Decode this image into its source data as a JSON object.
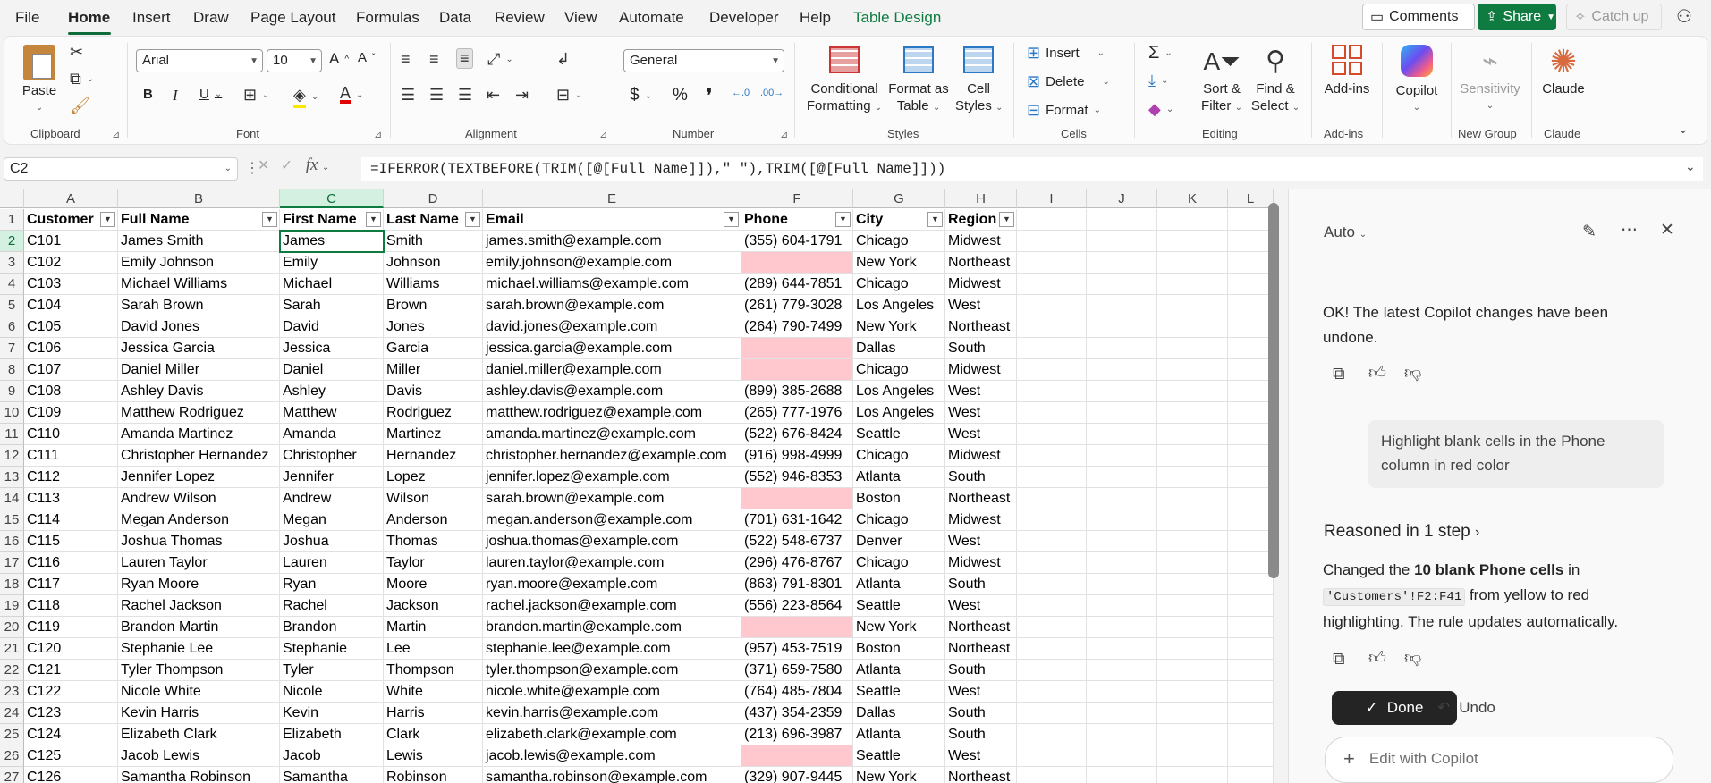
{
  "menu": {
    "items": [
      "File",
      "Home",
      "Insert",
      "Draw",
      "Page Layout",
      "Formulas",
      "Data",
      "Review",
      "View",
      "Automate",
      "Developer",
      "Help",
      "Table Design"
    ],
    "comments": "Comments",
    "share": "Share",
    "catchup": "Catch up"
  },
  "ribbon": {
    "clipboard": {
      "paste": "Paste",
      "group": "Clipboard"
    },
    "font": {
      "name": "Arial",
      "size": "10",
      "group": "Font"
    },
    "alignment": {
      "group": "Alignment"
    },
    "number": {
      "format": "General",
      "group": "Number"
    },
    "styles": {
      "cond1": "Conditional",
      "cond2": "Formatting",
      "fmt1": "Format as",
      "fmt2": "Table",
      "cell1": "Cell",
      "cell2": "Styles",
      "group": "Styles"
    },
    "cells": {
      "insert": "Insert",
      "delete": "Delete",
      "format": "Format",
      "group": "Cells"
    },
    "editing": {
      "sort1": "Sort &",
      "sort2": "Filter",
      "find1": "Find &",
      "find2": "Select",
      "group": "Editing"
    },
    "addins": {
      "label": "Add-ins",
      "group": "Add-ins"
    },
    "copilot": {
      "label": "Copilot"
    },
    "newgroup": {
      "label": "Sensitivity",
      "group": "New Group"
    },
    "claude": {
      "label": "Claude",
      "group": "Claude"
    }
  },
  "formula_bar": {
    "name_box": "C2",
    "formula": "=IFERROR(TEXTBEFORE(TRIM([@[Full Name]]),\" \"),TRIM([@[Full Name]]))"
  },
  "sheet": {
    "columns": [
      "A",
      "B",
      "C",
      "D",
      "E",
      "F",
      "G",
      "H",
      "I",
      "J",
      "K",
      "L"
    ],
    "headers": [
      "Customer",
      "Full Name",
      "First Name",
      "Last Name",
      "Email",
      "Phone",
      "City",
      "Region"
    ],
    "rows": [
      [
        "C101",
        "James Smith",
        "James",
        "Smith",
        "james.smith@example.com",
        "(355) 604-1791",
        "Chicago",
        "Midwest"
      ],
      [
        "C102",
        "Emily Johnson",
        "Emily",
        "Johnson",
        "emily.johnson@example.com",
        "",
        "New York",
        "Northeast"
      ],
      [
        "C103",
        "Michael Williams",
        "Michael",
        "Williams",
        "michael.williams@example.com",
        "(289) 644-7851",
        "Chicago",
        "Midwest"
      ],
      [
        "C104",
        "Sarah Brown",
        "Sarah",
        "Brown",
        "sarah.brown@example.com",
        "(261) 779-3028",
        "Los Angeles",
        "West"
      ],
      [
        "C105",
        "David Jones",
        "David",
        "Jones",
        "david.jones@example.com",
        "(264) 790-7499",
        "New York",
        "Northeast"
      ],
      [
        "C106",
        "Jessica Garcia",
        "Jessica",
        "Garcia",
        "jessica.garcia@example.com",
        "",
        "Dallas",
        "South"
      ],
      [
        "C107",
        "Daniel Miller",
        "Daniel",
        "Miller",
        "daniel.miller@example.com",
        "",
        "Chicago",
        "Midwest"
      ],
      [
        "C108",
        "Ashley Davis",
        "Ashley",
        "Davis",
        "ashley.davis@example.com",
        "(899) 385-2688",
        "Los Angeles",
        "West"
      ],
      [
        "C109",
        "Matthew Rodriguez",
        "Matthew",
        "Rodriguez",
        "matthew.rodriguez@example.com",
        "(265) 777-1976",
        "Los Angeles",
        "West"
      ],
      [
        "C110",
        "Amanda Martinez",
        "Amanda",
        "Martinez",
        "amanda.martinez@example.com",
        "(522) 676-8424",
        "Seattle",
        "West"
      ],
      [
        "C111",
        "Christopher Hernandez",
        "Christopher",
        "Hernandez",
        "christopher.hernandez@example.com",
        "(916) 998-4999",
        "Chicago",
        "Midwest"
      ],
      [
        "C112",
        "Jennifer Lopez",
        "Jennifer",
        "Lopez",
        "jennifer.lopez@example.com",
        "(552) 946-8353",
        "Atlanta",
        "South"
      ],
      [
        "C113",
        "Andrew Wilson",
        "Andrew",
        "Wilson",
        "sarah.brown@example.com",
        "",
        "Boston",
        "Northeast"
      ],
      [
        "C114",
        "Megan Anderson",
        "Megan",
        "Anderson",
        "megan.anderson@example.com",
        "(701) 631-1642",
        "Chicago",
        "Midwest"
      ],
      [
        "C115",
        "Joshua Thomas",
        "Joshua",
        "Thomas",
        "joshua.thomas@example.com",
        "(522) 548-6737",
        "Denver",
        "West"
      ],
      [
        "C116",
        "Lauren Taylor",
        "Lauren",
        "Taylor",
        "lauren.taylor@example.com",
        "(296) 476-8767",
        "Chicago",
        "Midwest"
      ],
      [
        "C117",
        "Ryan Moore",
        "Ryan",
        "Moore",
        "ryan.moore@example.com",
        "(863) 791-8301",
        "Atlanta",
        "South"
      ],
      [
        "C118",
        "Rachel Jackson",
        "Rachel",
        "Jackson",
        "rachel.jackson@example.com",
        "(556) 223-8564",
        "Seattle",
        "West"
      ],
      [
        "C119",
        "Brandon Martin",
        "Brandon",
        "Martin",
        "brandon.martin@example.com",
        "",
        "New York",
        "Northeast"
      ],
      [
        "C120",
        "Stephanie Lee",
        "Stephanie",
        "Lee",
        "stephanie.lee@example.com",
        "(957) 453-7519",
        "Boston",
        "Northeast"
      ],
      [
        "C121",
        "Tyler Thompson",
        "Tyler",
        "Thompson",
        "tyler.thompson@example.com",
        "(371) 659-7580",
        "Atlanta",
        "South"
      ],
      [
        "C122",
        "Nicole White",
        "Nicole",
        "White",
        "nicole.white@example.com",
        "(764) 485-7804",
        "Seattle",
        "West"
      ],
      [
        "C123",
        "Kevin Harris",
        "Kevin",
        "Harris",
        "kevin.harris@example.com",
        "(437) 354-2359",
        "Dallas",
        "South"
      ],
      [
        "C124",
        "Elizabeth Clark",
        "Elizabeth",
        "Clark",
        "elizabeth.clark@example.com",
        "(213) 696-3987",
        "Atlanta",
        "South"
      ],
      [
        "C125",
        "Jacob Lewis",
        "Jacob",
        "Lewis",
        "jacob.lewis@example.com",
        "",
        "Seattle",
        "West"
      ],
      [
        "C126",
        "Samantha Robinson",
        "Samantha",
        "Robinson",
        "samantha.robinson@example.com",
        "(329) 907-9445",
        "New York",
        "Northeast"
      ]
    ],
    "blank_fill_color": "#ffc7ce",
    "accent": "#0f7b41"
  },
  "copilot": {
    "mode": "Auto",
    "msg1": "OK! The latest Copilot changes have been undone.",
    "user_msg": "Highlight blank cells in the Phone column in red color",
    "reasoned": "Reasoned in 1 step",
    "resp_a": "Changed the ",
    "resp_bold": "10 blank Phone cells",
    "resp_b": " in",
    "resp_code": "'Customers'!F2:F41",
    "resp_c": " from yellow to red highlighting. The rule updates automatically.",
    "done": "Done",
    "undo": "Undo",
    "edit_placeholder": "Edit with Copilot"
  }
}
